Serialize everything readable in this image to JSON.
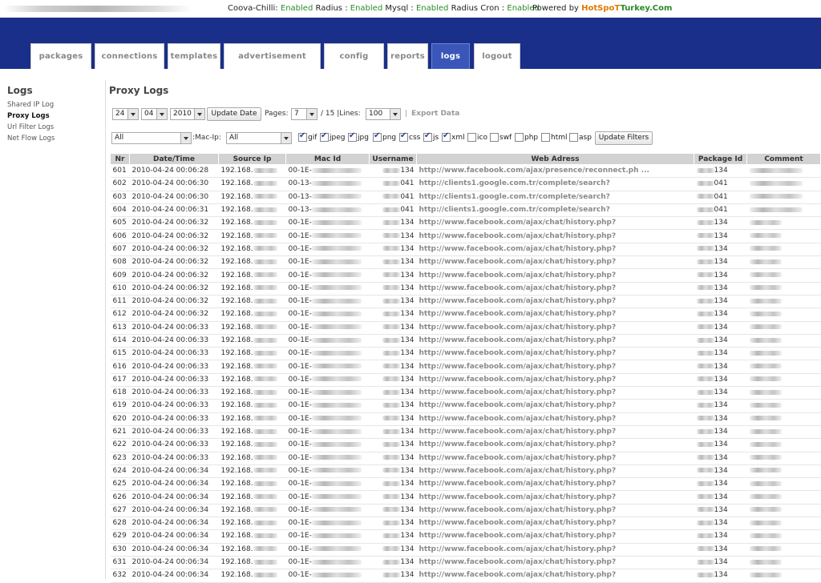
{
  "topbar": {
    "coova": "Coova-Chilli:",
    "radius": "Radius :",
    "mysql": "Mysql :",
    "radiuscron": "Radius Cron :",
    "enabled": "Enabled",
    "powered": "Powered by",
    "brand_hot": "HotSpoT",
    "brand_turkey": "Turkey.Com"
  },
  "tabs": [
    "packages",
    "connections",
    "templates",
    "advertisement",
    "config",
    "reports",
    "logs",
    "logout"
  ],
  "sidebar": {
    "title": "Logs",
    "items": [
      "Shared IP Log",
      "Proxy Logs",
      "Url Filter Logs",
      "Net Flow Logs"
    ]
  },
  "main": {
    "title": "Proxy Logs",
    "day": "24",
    "month": "04",
    "year": "2010",
    "update_date": "Update Date",
    "pages_label": "Pages:",
    "page": "7",
    "pages_total": "/ 15 |Lines:",
    "lines": "100",
    "sep": "|",
    "export": "Export Data",
    "filter1": "All",
    "mac_ip_label": ":Mac-Ip:",
    "filter2": "All",
    "update_filters": "Update Filters",
    "ext_filters": [
      {
        "label": "gif",
        "checked": true
      },
      {
        "label": "jpeg",
        "checked": true
      },
      {
        "label": "jpg",
        "checked": true
      },
      {
        "label": "png",
        "checked": true
      },
      {
        "label": "css",
        "checked": true
      },
      {
        "label": "js",
        "checked": true
      },
      {
        "label": "xml",
        "checked": true
      },
      {
        "label": "ico",
        "checked": false
      },
      {
        "label": "swf",
        "checked": false
      },
      {
        "label": "php",
        "checked": false
      },
      {
        "label": "html",
        "checked": false
      },
      {
        "label": "asp",
        "checked": false
      }
    ]
  },
  "table": {
    "headers": [
      "Nr",
      "Date/Time",
      "Source Ip",
      "Mac Id",
      "Username",
      "Web Adress",
      "Package Id",
      "Comment"
    ],
    "rows": [
      [
        "601",
        "2010-04-24 00:06:28",
        "192.168.",
        "00-1E-",
        "134",
        "http://www.facebook.com/ajax/presence/reconnect.ph ...",
        "134"
      ],
      [
        "602",
        "2010-04-24 00:06:30",
        "192.168.",
        "00-13-",
        "041",
        "http://clients1.google.com.tr/complete/search?",
        "041"
      ],
      [
        "603",
        "2010-04-24 00:06:30",
        "192.168.",
        "00-13-",
        "041",
        "http://clients1.google.com.tr/complete/search?",
        "041"
      ],
      [
        "604",
        "2010-04-24 00:06:31",
        "192.168.",
        "00-13-",
        "041",
        "http://clients1.google.com.tr/complete/search?",
        "041"
      ],
      [
        "605",
        "2010-04-24 00:06:32",
        "192.168.",
        "00-1E-",
        "134",
        "http://www.facebook.com/ajax/chat/history.php?",
        "134"
      ],
      [
        "606",
        "2010-04-24 00:06:32",
        "192.168.",
        "00-1E-",
        "134",
        "http://www.facebook.com/ajax/chat/history.php?",
        "134"
      ],
      [
        "607",
        "2010-04-24 00:06:32",
        "192.168.",
        "00-1E-",
        "134",
        "http://www.facebook.com/ajax/chat/history.php?",
        "134"
      ],
      [
        "608",
        "2010-04-24 00:06:32",
        "192.168.",
        "00-1E-",
        "134",
        "http://www.facebook.com/ajax/chat/history.php?",
        "134"
      ],
      [
        "609",
        "2010-04-24 00:06:32",
        "192.168.",
        "00-1E-",
        "134",
        "http://www.facebook.com/ajax/chat/history.php?",
        "134"
      ],
      [
        "610",
        "2010-04-24 00:06:32",
        "192.168.",
        "00-1E-",
        "134",
        "http://www.facebook.com/ajax/chat/history.php?",
        "134"
      ],
      [
        "611",
        "2010-04-24 00:06:32",
        "192.168.",
        "00-1E-",
        "134",
        "http://www.facebook.com/ajax/chat/history.php?",
        "134"
      ],
      [
        "612",
        "2010-04-24 00:06:32",
        "192.168.",
        "00-1E-",
        "134",
        "http://www.facebook.com/ajax/chat/history.php?",
        "134"
      ],
      [
        "613",
        "2010-04-24 00:06:33",
        "192.168.",
        "00-1E-",
        "134",
        "http://www.facebook.com/ajax/chat/history.php?",
        "134"
      ],
      [
        "614",
        "2010-04-24 00:06:33",
        "192.168.",
        "00-1E-",
        "134",
        "http://www.facebook.com/ajax/chat/history.php?",
        "134"
      ],
      [
        "615",
        "2010-04-24 00:06:33",
        "192.168.",
        "00-1E-",
        "134",
        "http://www.facebook.com/ajax/chat/history.php?",
        "134"
      ],
      [
        "616",
        "2010-04-24 00:06:33",
        "192.168.",
        "00-1E-",
        "134",
        "http://www.facebook.com/ajax/chat/history.php?",
        "134"
      ],
      [
        "617",
        "2010-04-24 00:06:33",
        "192.168.",
        "00-1E-",
        "134",
        "http://www.facebook.com/ajax/chat/history.php?",
        "134"
      ],
      [
        "618",
        "2010-04-24 00:06:33",
        "192.168.",
        "00-1E-",
        "134",
        "http://www.facebook.com/ajax/chat/history.php?",
        "134"
      ],
      [
        "619",
        "2010-04-24 00:06:33",
        "192.168.",
        "00-1E-",
        "134",
        "http://www.facebook.com/ajax/chat/history.php?",
        "134"
      ],
      [
        "620",
        "2010-04-24 00:06:33",
        "192.168.",
        "00-1E-",
        "134",
        "http://www.facebook.com/ajax/chat/history.php?",
        "134"
      ],
      [
        "621",
        "2010-04-24 00:06:33",
        "192.168.",
        "00-1E-",
        "134",
        "http://www.facebook.com/ajax/chat/history.php?",
        "134"
      ],
      [
        "622",
        "2010-04-24 00:06:33",
        "192.168.",
        "00-1E-",
        "134",
        "http://www.facebook.com/ajax/chat/history.php?",
        "134"
      ],
      [
        "623",
        "2010-04-24 00:06:33",
        "192.168.",
        "00-1E-",
        "134",
        "http://www.facebook.com/ajax/chat/history.php?",
        "134"
      ],
      [
        "624",
        "2010-04-24 00:06:34",
        "192.168.",
        "00-1E-",
        "134",
        "http://www.facebook.com/ajax/chat/history.php?",
        "134"
      ],
      [
        "625",
        "2010-04-24 00:06:34",
        "192.168.",
        "00-1E-",
        "134",
        "http://www.facebook.com/ajax/chat/history.php?",
        "134"
      ],
      [
        "626",
        "2010-04-24 00:06:34",
        "192.168.",
        "00-1E-",
        "134",
        "http://www.facebook.com/ajax/chat/history.php?",
        "134"
      ],
      [
        "627",
        "2010-04-24 00:06:34",
        "192.168.",
        "00-1E-",
        "134",
        "http://www.facebook.com/ajax/chat/history.php?",
        "134"
      ],
      [
        "628",
        "2010-04-24 00:06:34",
        "192.168.",
        "00-1E-",
        "134",
        "http://www.facebook.com/ajax/chat/history.php?",
        "134"
      ],
      [
        "629",
        "2010-04-24 00:06:34",
        "192.168.",
        "00-1E-",
        "134",
        "http://www.facebook.com/ajax/chat/history.php?",
        "134"
      ],
      [
        "630",
        "2010-04-24 00:06:34",
        "192.168.",
        "00-1E-",
        "134",
        "http://www.facebook.com/ajax/chat/history.php?",
        "134"
      ],
      [
        "631",
        "2010-04-24 00:06:34",
        "192.168.",
        "00-1E-",
        "134",
        "http://www.facebook.com/ajax/chat/history.php?",
        "134"
      ],
      [
        "632",
        "2010-04-24 00:06:34",
        "192.168.",
        "00-1E-",
        "134",
        "http://www.facebook.com/ajax/chat/history.php?",
        "134"
      ]
    ]
  }
}
